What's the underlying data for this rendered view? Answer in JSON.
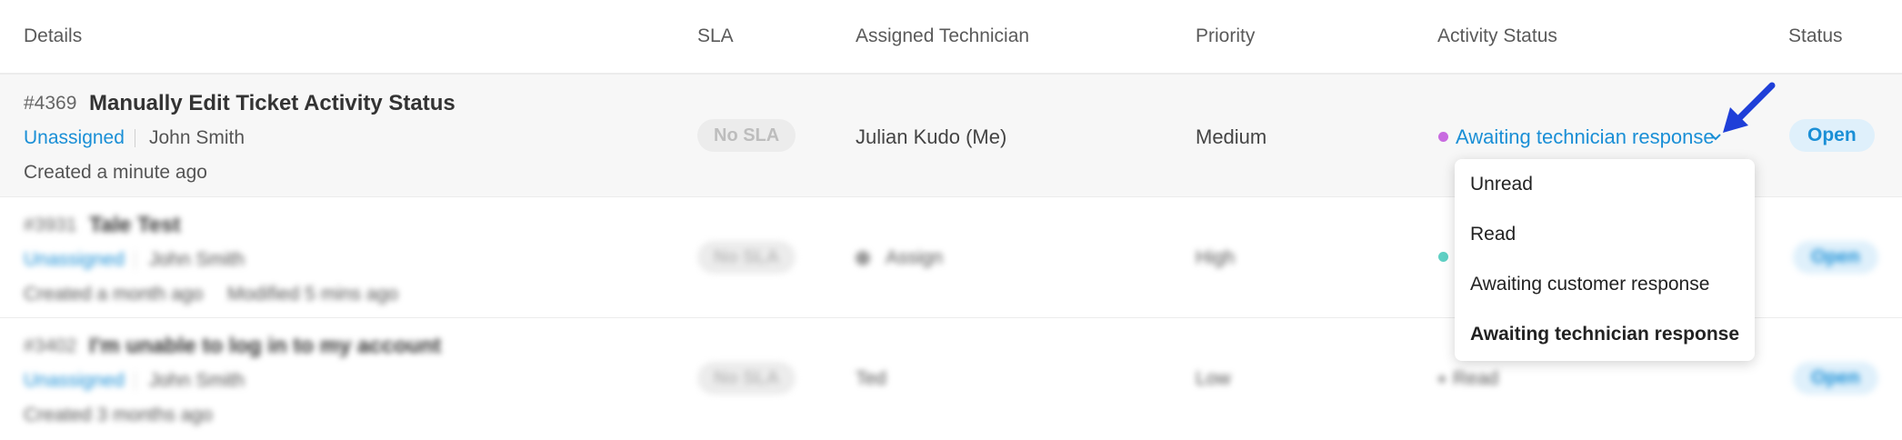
{
  "headers": {
    "details": "Details",
    "sla": "SLA",
    "technician": "Assigned Technician",
    "priority": "Priority",
    "activity_status": "Activity Status",
    "status": "Status"
  },
  "ticket1": {
    "id": "#4369",
    "title": "Manually Edit Ticket Activity Status",
    "assignee": "Unassigned",
    "requester": "John Smith",
    "created": "Created a minute ago",
    "sla": "No SLA",
    "technician": "Julian Kudo (Me)",
    "priority": "Medium",
    "activity_status": "Awaiting technician response",
    "status": "Open",
    "activity_dot_color": "#c86be0"
  },
  "ticket2": {
    "id": "#3931",
    "title": "Tale Test",
    "assignee": "Unassigned",
    "requester": "John Smith",
    "created": "Created a month ago",
    "modified": "Modified 5 mins ago",
    "sla": "No SLA",
    "technician": "Assign",
    "priority": "High",
    "status": "Open",
    "activity_dot_color": "#5fd0c4"
  },
  "ticket3": {
    "id": "#3402",
    "title": "I'm unable to log in to my account",
    "assignee": "Unassigned",
    "requester": "John Smith",
    "created": "Created 3 months ago",
    "sla": "No SLA",
    "technician": "Ted",
    "priority": "Low",
    "activity_status": "Read",
    "status": "Open"
  },
  "dropdown": {
    "options": [
      "Unread",
      "Read",
      "Awaiting customer response",
      "Awaiting technician response"
    ],
    "selected": "Awaiting technician response"
  },
  "colors": {
    "link": "#1a8fd6",
    "arrow": "#1f3fd8",
    "open_badge_bg": "#dff0fb"
  }
}
